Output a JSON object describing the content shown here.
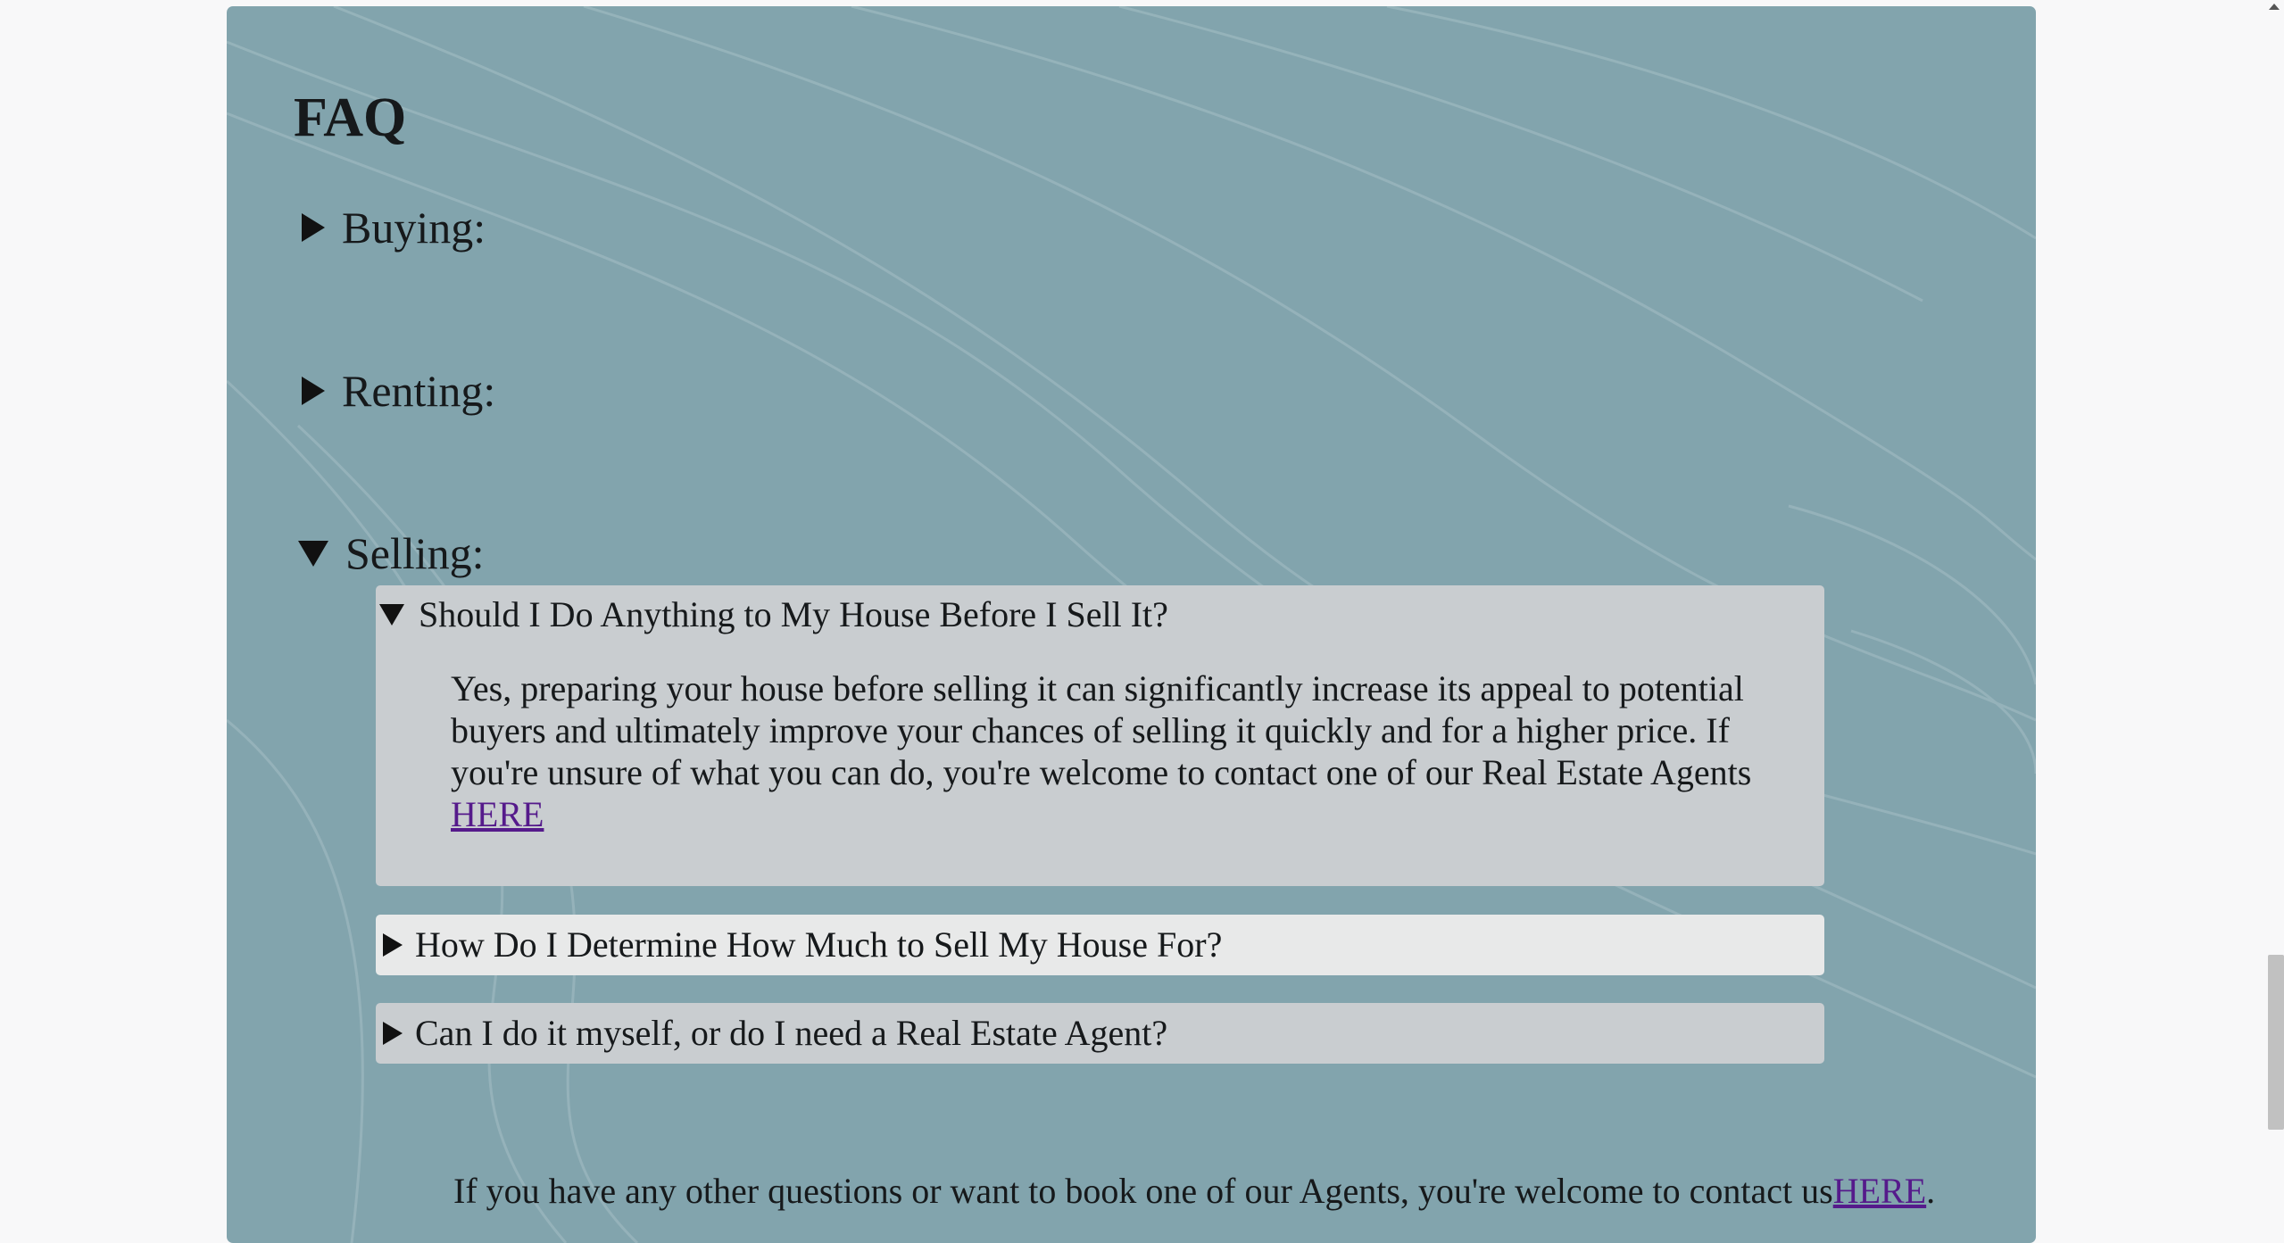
{
  "faq": {
    "title": "FAQ",
    "categories": [
      {
        "label": "Buying:",
        "expanded": false
      },
      {
        "label": "Renting:",
        "expanded": false
      },
      {
        "label": "Selling:",
        "expanded": true
      }
    ],
    "selling_questions": [
      {
        "question": "Should I Do Anything to My House Before I Sell It?",
        "expanded": true,
        "answer": "Yes, preparing your house before selling it can significantly increase its appeal to potential buyers and ultimately improve your chances of selling it quickly and for a higher price. If you're unsure of what you can do, you're welcome to contact one of our Real Estate Agents ",
        "answer_link": "HERE"
      },
      {
        "question": "How Do I Determine How Much to Sell My House For?",
        "expanded": false,
        "hovered": true
      },
      {
        "question": "Can I do it myself, or do I need a Real Estate Agent?",
        "expanded": false
      }
    ],
    "contact": {
      "text": "If you have any other questions or want to book one of our Agents, you're welcome to contact us",
      "link": "HERE",
      "suffix": "."
    }
  },
  "colors": {
    "panel": "#82a4ad",
    "question_box": "#c9cdd0",
    "question_box_hover": "#e8e9e9",
    "link": "#551a8b",
    "page_bg": "#f8f8f9"
  }
}
